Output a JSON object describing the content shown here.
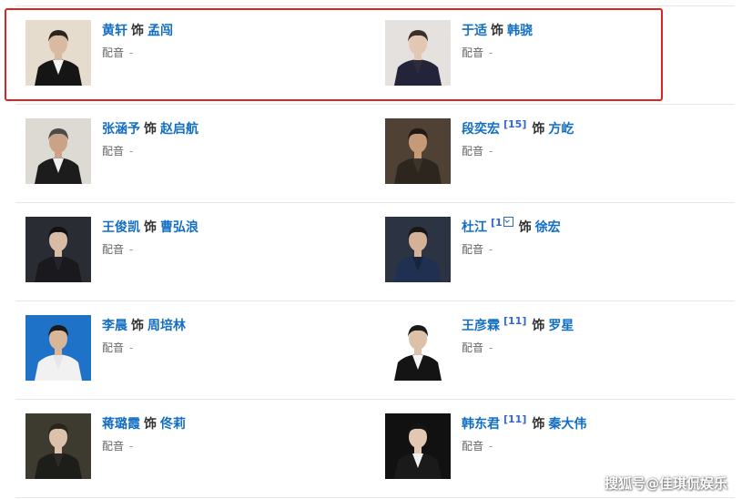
{
  "cast": [
    {
      "actor": "黄轩",
      "cite": "",
      "role_word": "饰",
      "role": "孟闯",
      "dub_label": "配音",
      "dub_value": "-",
      "photo": {
        "bg": "#e6dccd",
        "suit": "#151515",
        "shirt": "#f4f4f4",
        "skin": "#d9b9a0",
        "hair": "#2a2420"
      }
    },
    {
      "actor": "于适",
      "cite": "",
      "role_word": "饰",
      "role": "韩骁",
      "dub_label": "配音",
      "dub_value": "-",
      "photo": {
        "bg": "#e4e1de",
        "suit": "#23233a",
        "shirt": "#2c2c3d",
        "skin": "#e4c7b3",
        "hair": "#3a2e28"
      }
    },
    {
      "actor": "张涵予",
      "cite": "",
      "role_word": "饰",
      "role": "赵启航",
      "dub_label": "配音",
      "dub_value": "-",
      "photo": {
        "bg": "#ddd9d3",
        "suit": "#1c1c1c",
        "shirt": "#f0f0f0",
        "skin": "#caa287",
        "hair": "#4a4a4a"
      }
    },
    {
      "actor": "段奕宏",
      "cite": "[15]",
      "role_word": "饰",
      "role": "方屹",
      "dub_label": "配音",
      "dub_value": "-",
      "photo": {
        "bg": "#4f4234",
        "suit": "#2d261f",
        "shirt": "#3d342a",
        "skin": "#c59a77",
        "hair": "#221a14"
      }
    },
    {
      "actor": "杜江",
      "cite": "[1",
      "cite_icon": true,
      "role_word": "饰",
      "role": "徐宏",
      "dub_label": "配音",
      "dub_value": "-",
      "photo": {
        "bg": "#2c3342",
        "suit": "#1f3050",
        "shirt": "#18243c",
        "skin": "#d4b197",
        "hair": "#171717"
      }
    },
    {
      "actor": "王俊凯",
      "cite": "",
      "role_word": "饰",
      "role": "曹弘浪",
      "dub_label": "配音",
      "dub_value": "-",
      "photo": {
        "bg": "#2a2c33",
        "suit": "#1a1a1e",
        "shirt": "#24242a",
        "skin": "#d8bca6",
        "hair": "#111114"
      }
    },
    {
      "actor": "李晨",
      "cite": "",
      "role_word": "饰",
      "role": "周培林",
      "dub_label": "配音",
      "dub_value": "-",
      "photo": {
        "bg": "#1e72c8",
        "suit": "#f1f1f1",
        "shirt": "#e6e6e6",
        "skin": "#d8b697",
        "hair": "#1b1b1b"
      }
    },
    {
      "actor": "王彦霖",
      "cite": "[11]",
      "role_word": "饰",
      "role": "罗星",
      "dub_label": "配音",
      "dub_value": "-",
      "photo": {
        "bg": "#ffffff",
        "suit": "#141414",
        "shirt": "#f5f5f5",
        "skin": "#dcc0a8",
        "hair": "#1a1a1a"
      }
    },
    {
      "actor": "蒋璐霞",
      "cite": "",
      "role_word": "饰",
      "role": "佟莉",
      "dub_label": "配音",
      "dub_value": "-",
      "photo": {
        "bg": "#3d3a2f",
        "suit": "#1d1d19",
        "shirt": "#2b2a24",
        "skin": "#dcc2aa",
        "hair": "#2b241c"
      }
    },
    {
      "actor": "韩东君",
      "cite": "[11]",
      "role_word": "饰",
      "role": "秦大伟",
      "dub_label": "配音",
      "dub_value": "-",
      "photo": {
        "bg": "#111111",
        "suit": "#1a1a1a",
        "shirt": "#efefef",
        "skin": "#e2c8b2",
        "hair": "#141414"
      }
    }
  ],
  "watermark": "搜狐号@佳琪侃娱乐",
  "colors": {
    "link": "#136ec2",
    "highlight_border": "#dd2222",
    "divider": "#e6e6e6",
    "muted": "#666666"
  }
}
